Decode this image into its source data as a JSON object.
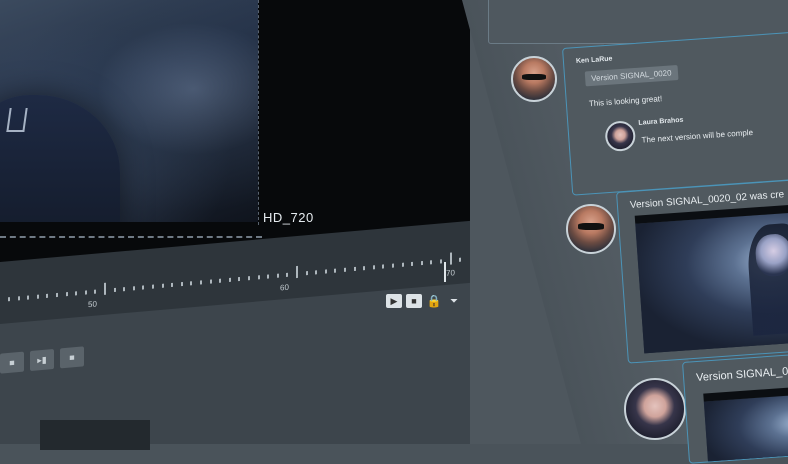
{
  "viewer": {
    "format_label": "HD_720"
  },
  "timeline": {
    "tick_labels": [
      "50",
      "60",
      "70"
    ],
    "current_frame": "70",
    "out_frame": "70"
  },
  "comments": [
    {
      "author": "Ken LaRue",
      "version_chip": "Version SIGNAL_0020",
      "text": "This is looking great!",
      "reply": {
        "author": "Laura Brahos",
        "text": "The next version will be comple"
      }
    },
    {
      "text": "Version SIGNAL_0020_02 was cre"
    },
    {
      "text": "Version SIGNAL_0"
    }
  ],
  "colors": {
    "accent": "#4b94b8",
    "panel_bg": "#4e575e",
    "viewer_bg": "#07090b"
  }
}
